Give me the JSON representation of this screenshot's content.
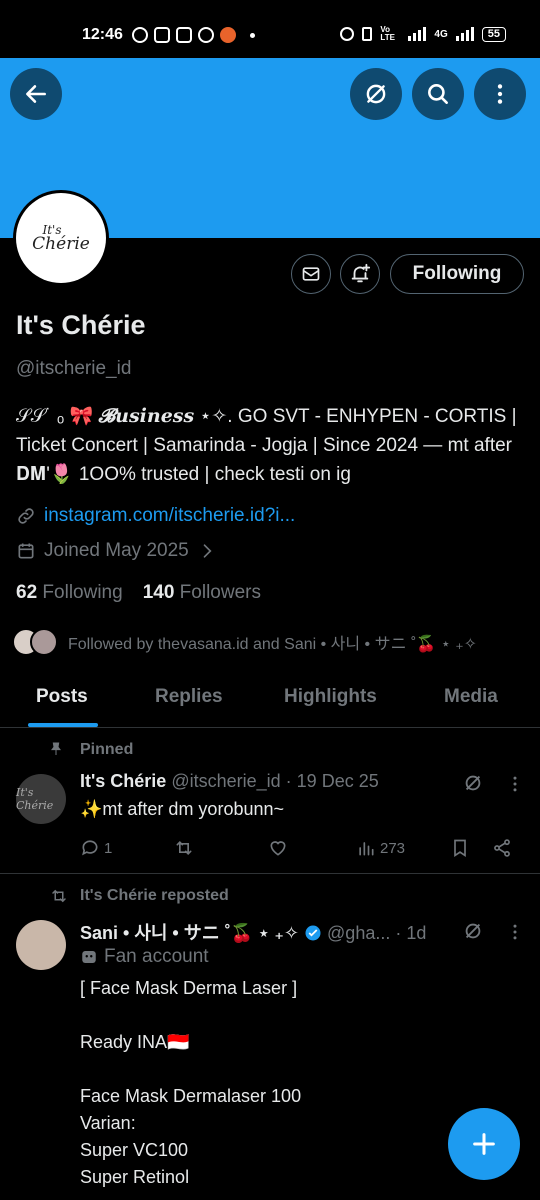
{
  "status": {
    "time": "12:46",
    "network": "4G",
    "volte": "Vo LTE",
    "battery": "55"
  },
  "profile": {
    "display_name": "It's Chérie",
    "handle": "@itscherie_id",
    "avatar_text_line1": "It's",
    "avatar_text_line2": "Chérie",
    "bio_prefix": "𝒮𝒮˙ ₒ 🎀 ",
    "bio_business": "𝓑usiness",
    "bio_rest": " ⋆✧. GO SVT - ENHYPEN - CORTIS | Ticket Concert | Samarinda - Jogja | Since 2024 — mt after 𝐃𝐌'🌷 1OO% trusted | check testi on ig",
    "link": "instagram.com/itscherie.id?i...",
    "joined": "Joined May 2025",
    "following_count": "62",
    "following_label": "Following",
    "followers_count": "140",
    "followers_label": "Followers",
    "followed_by": "Followed by thevasana.id and Sani • 사니 • サニ ˚🍒 ⋆ ₊✧"
  },
  "buttons": {
    "follow_state": "Following"
  },
  "tabs": [
    {
      "label": "Posts",
      "active": true
    },
    {
      "label": "Replies",
      "active": false
    },
    {
      "label": "Highlights",
      "active": false
    },
    {
      "label": "Media",
      "active": false
    }
  ],
  "pinned_tweet": {
    "pinned_label": "Pinned",
    "author_name": "It's Chérie",
    "author_handle": "@itscherie_id",
    "date": "· 19 Dec 25",
    "avatar_text": "It's Chérie",
    "text": "✨mt after dm yorobunn~",
    "reply_count": "1",
    "views": "273"
  },
  "repost_tweet": {
    "repost_label": "It's Chérie reposted",
    "author_name": "Sani • 사니 • サニ ˚🍒 ⋆ ₊✧",
    "author_handle": "@gha...",
    "date": "· 1d",
    "badge_label": "Fan account",
    "text_lines": [
      "[ Face Mask Derma Laser ]",
      "",
      "Ready INA🇮🇩",
      "",
      "Face Mask Dermalaser 100",
      "Varian:",
      "Super VC100",
      "Super Retinol"
    ]
  },
  "colors": {
    "accent": "#1d9bf0",
    "background": "#000000",
    "text_primary": "#e7e9ea",
    "text_secondary": "#71767b",
    "border": "#2f3336"
  }
}
